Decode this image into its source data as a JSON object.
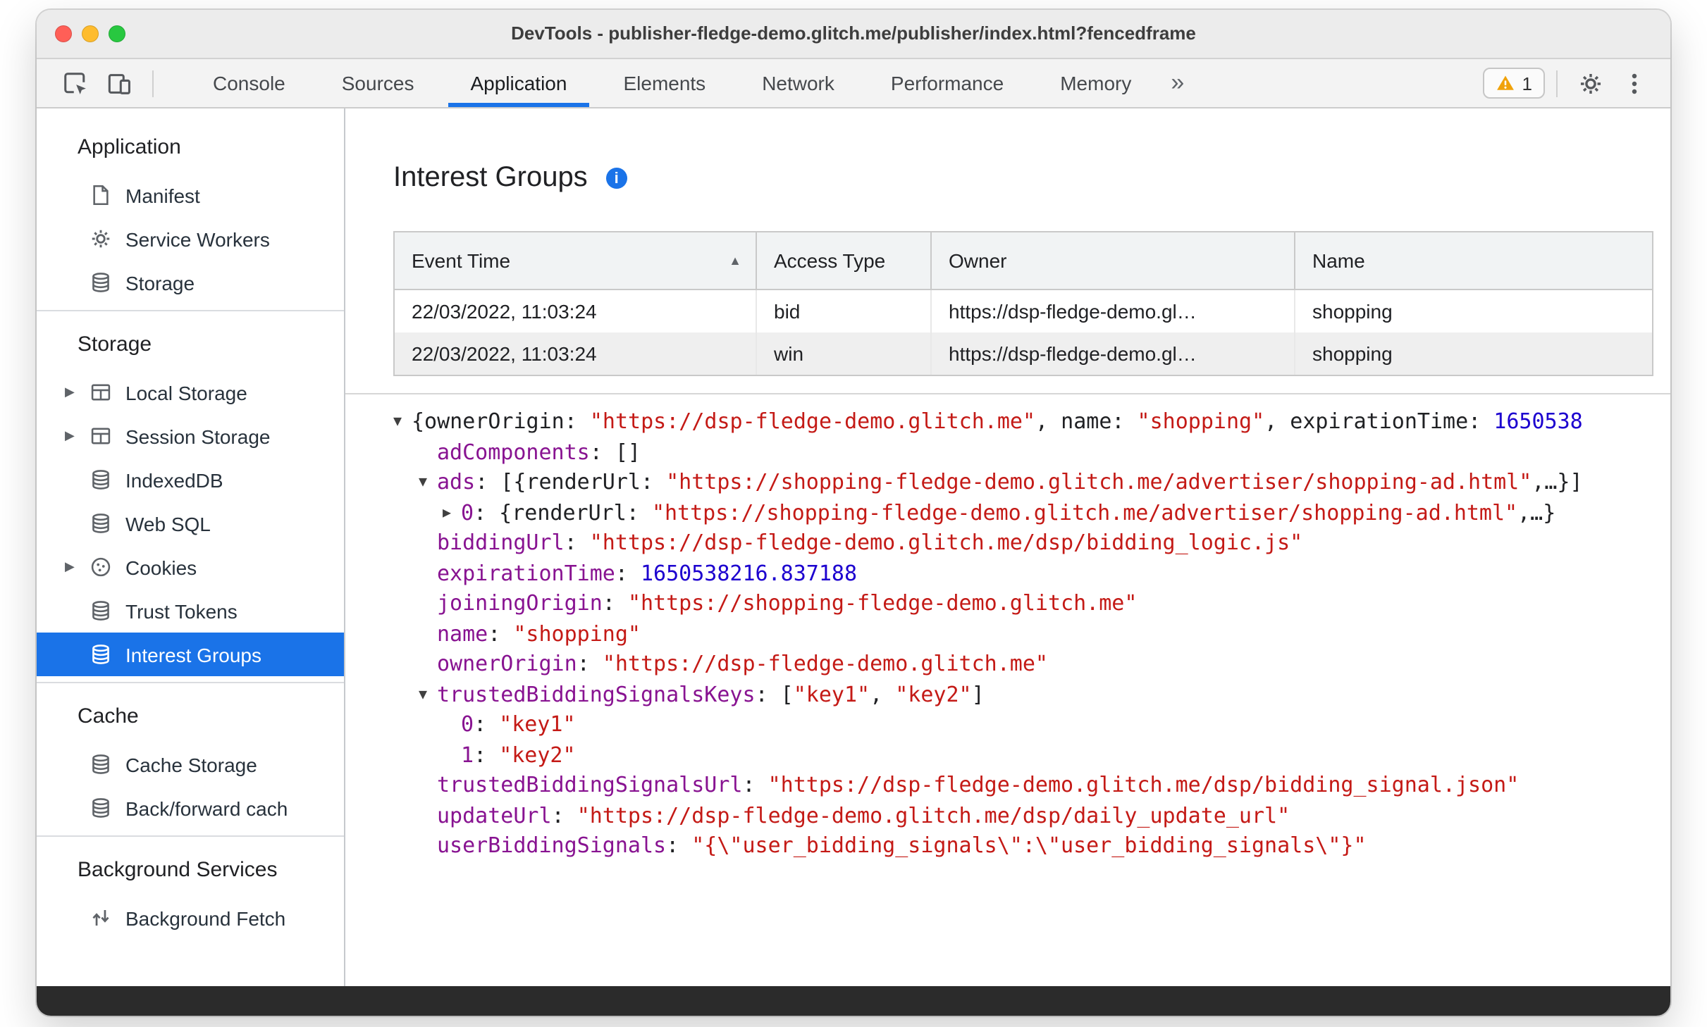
{
  "window": {
    "title": "DevTools - publisher-fledge-demo.glitch.me/publisher/index.html?fencedframe"
  },
  "colors": {
    "accent_blue": "#1a73e8",
    "selected_item_bg": "#1a73e8",
    "tree_key_purple": "#881391",
    "tree_string_red": "#c41a16",
    "tree_number_blue": "#1c00cf",
    "warning_amber": "#f0a20a",
    "traffic_red": "#ff5f57",
    "traffic_yellow": "#febc2e",
    "traffic_green": "#28c840"
  },
  "toolbar": {
    "tabs": [
      {
        "label": "Console"
      },
      {
        "label": "Sources"
      },
      {
        "label": "Application",
        "active": true
      },
      {
        "label": "Elements"
      },
      {
        "label": "Network"
      },
      {
        "label": "Performance"
      },
      {
        "label": "Memory"
      }
    ],
    "overflow_icon": "»",
    "warning_count": "1",
    "icons": [
      "inspect-element-icon",
      "device-toolbar-icon",
      "warning-icon",
      "settings-gear-icon",
      "kebab-menu-icon"
    ]
  },
  "sidebar": {
    "sections": [
      {
        "title": "Application",
        "items": [
          {
            "label": "Manifest",
            "icon": "manifest-icon"
          },
          {
            "label": "Service Workers",
            "icon": "service-workers-icon"
          },
          {
            "label": "Storage",
            "icon": "database-icon"
          }
        ]
      },
      {
        "title": "Storage",
        "items": [
          {
            "label": "Local Storage",
            "icon": "table-icon",
            "expandable": true
          },
          {
            "label": "Session Storage",
            "icon": "table-icon",
            "expandable": true
          },
          {
            "label": "IndexedDB",
            "icon": "database-icon"
          },
          {
            "label": "Web SQL",
            "icon": "database-icon"
          },
          {
            "label": "Cookies",
            "icon": "cookie-icon",
            "expandable": true
          },
          {
            "label": "Trust Tokens",
            "icon": "database-icon"
          },
          {
            "label": "Interest Groups",
            "icon": "database-icon",
            "selected": true
          }
        ]
      },
      {
        "title": "Cache",
        "items": [
          {
            "label": "Cache Storage",
            "icon": "database-icon"
          },
          {
            "label": "Back/forward cach",
            "icon": "database-icon"
          }
        ]
      },
      {
        "title": "Background Services",
        "items": [
          {
            "label": "Background Fetch",
            "icon": "background-fetch-icon"
          }
        ]
      }
    ]
  },
  "main": {
    "title": "Interest Groups",
    "table": {
      "columns": [
        {
          "label": "Event Time",
          "sort": "asc"
        },
        {
          "label": "Access Type"
        },
        {
          "label": "Owner"
        },
        {
          "label": "Name"
        }
      ],
      "rows": [
        {
          "cells": [
            "22/03/2022, 11:03:24",
            "bid",
            "https://dsp-fledge-demo.gl…",
            "shopping"
          ]
        },
        {
          "cells": [
            "22/03/2022, 11:03:24",
            "win",
            "https://dsp-fledge-demo.gl…",
            "shopping"
          ],
          "striped": true
        }
      ]
    },
    "tree": {
      "lines": [
        {
          "indent": 0,
          "arrow": "down",
          "segments": [
            {
              "t": "{ownerOrigin: ",
              "c": "plain"
            },
            {
              "t": "\"https://dsp-fledge-demo.glitch.me\"",
              "c": "string"
            },
            {
              "t": ", name: ",
              "c": "plain"
            },
            {
              "t": "\"shopping\"",
              "c": "string"
            },
            {
              "t": ", expirationTime: ",
              "c": "plain"
            },
            {
              "t": "1650538",
              "c": "number"
            }
          ]
        },
        {
          "indent": 1,
          "arrow": null,
          "segments": [
            {
              "t": "adComponents",
              "c": "key"
            },
            {
              "t": ": []",
              "c": "plain"
            }
          ]
        },
        {
          "indent": 1,
          "arrow": "down",
          "segments": [
            {
              "t": "ads",
              "c": "key"
            },
            {
              "t": ": [{renderUrl: ",
              "c": "plain"
            },
            {
              "t": "\"https://shopping-fledge-demo.glitch.me/advertiser/shopping-ad.html\"",
              "c": "string"
            },
            {
              "t": ",…}]",
              "c": "plain"
            }
          ]
        },
        {
          "indent": 2,
          "arrow": "right",
          "segments": [
            {
              "t": "0",
              "c": "key"
            },
            {
              "t": ": {renderUrl: ",
              "c": "plain"
            },
            {
              "t": "\"https://shopping-fledge-demo.glitch.me/advertiser/shopping-ad.html\"",
              "c": "string"
            },
            {
              "t": ",…}",
              "c": "plain"
            }
          ]
        },
        {
          "indent": 1,
          "arrow": null,
          "segments": [
            {
              "t": "biddingUrl",
              "c": "key"
            },
            {
              "t": ": ",
              "c": "plain"
            },
            {
              "t": "\"https://dsp-fledge-demo.glitch.me/dsp/bidding_logic.js\"",
              "c": "string"
            }
          ]
        },
        {
          "indent": 1,
          "arrow": null,
          "segments": [
            {
              "t": "expirationTime",
              "c": "key"
            },
            {
              "t": ": ",
              "c": "plain"
            },
            {
              "t": "1650538216.837188",
              "c": "number"
            }
          ]
        },
        {
          "indent": 1,
          "arrow": null,
          "segments": [
            {
              "t": "joiningOrigin",
              "c": "key"
            },
            {
              "t": ": ",
              "c": "plain"
            },
            {
              "t": "\"https://shopping-fledge-demo.glitch.me\"",
              "c": "string"
            }
          ]
        },
        {
          "indent": 1,
          "arrow": null,
          "segments": [
            {
              "t": "name",
              "c": "key"
            },
            {
              "t": ": ",
              "c": "plain"
            },
            {
              "t": "\"shopping\"",
              "c": "string"
            }
          ]
        },
        {
          "indent": 1,
          "arrow": null,
          "segments": [
            {
              "t": "ownerOrigin",
              "c": "key"
            },
            {
              "t": ": ",
              "c": "plain"
            },
            {
              "t": "\"https://dsp-fledge-demo.glitch.me\"",
              "c": "string"
            }
          ]
        },
        {
          "indent": 1,
          "arrow": "down",
          "segments": [
            {
              "t": "trustedBiddingSignalsKeys",
              "c": "key"
            },
            {
              "t": ": [",
              "c": "plain"
            },
            {
              "t": "\"key1\"",
              "c": "string"
            },
            {
              "t": ", ",
              "c": "plain"
            },
            {
              "t": "\"key2\"",
              "c": "string"
            },
            {
              "t": "]",
              "c": "plain"
            }
          ]
        },
        {
          "indent": 2,
          "arrow": null,
          "segments": [
            {
              "t": "0",
              "c": "key"
            },
            {
              "t": ": ",
              "c": "plain"
            },
            {
              "t": "\"key1\"",
              "c": "string"
            }
          ]
        },
        {
          "indent": 2,
          "arrow": null,
          "segments": [
            {
              "t": "1",
              "c": "key"
            },
            {
              "t": ": ",
              "c": "plain"
            },
            {
              "t": "\"key2\"",
              "c": "string"
            }
          ]
        },
        {
          "indent": 1,
          "arrow": null,
          "segments": [
            {
              "t": "trustedBiddingSignalsUrl",
              "c": "key"
            },
            {
              "t": ": ",
              "c": "plain"
            },
            {
              "t": "\"https://dsp-fledge-demo.glitch.me/dsp/bidding_signal.json\"",
              "c": "string"
            }
          ]
        },
        {
          "indent": 1,
          "arrow": null,
          "segments": [
            {
              "t": "updateUrl",
              "c": "key"
            },
            {
              "t": ": ",
              "c": "plain"
            },
            {
              "t": "\"https://dsp-fledge-demo.glitch.me/dsp/daily_update_url\"",
              "c": "string"
            }
          ]
        },
        {
          "indent": 1,
          "arrow": null,
          "segments": [
            {
              "t": "userBiddingSignals",
              "c": "key"
            },
            {
              "t": ": ",
              "c": "plain"
            },
            {
              "t": "\"{\\\"user_bidding_signals\\\":\\\"user_bidding_signals\\\"}\"",
              "c": "string"
            }
          ]
        }
      ]
    }
  }
}
